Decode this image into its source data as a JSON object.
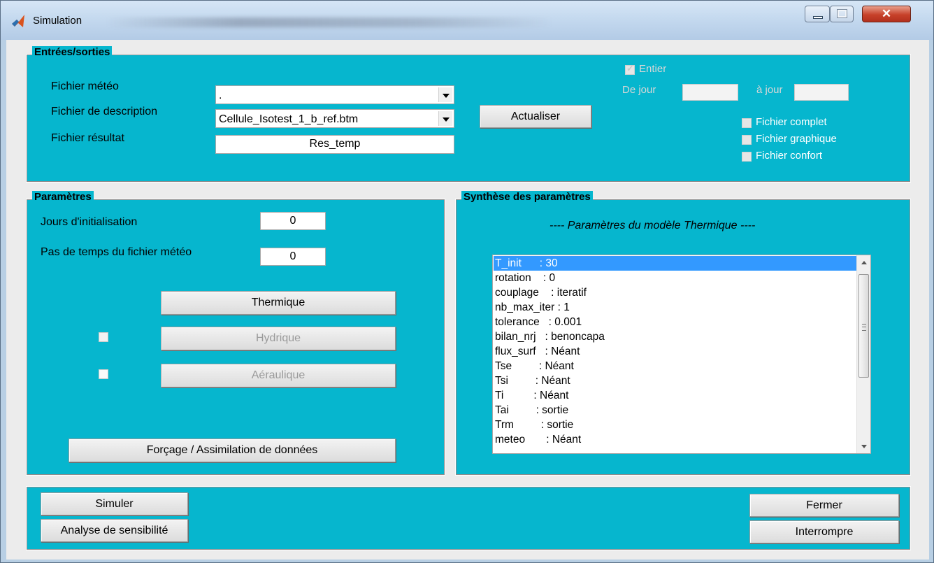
{
  "window": {
    "title": "Simulation",
    "colors": {
      "panel_bg": "#06b6ce",
      "button_bg": "#dcdcdc",
      "selection": "#3399ff"
    }
  },
  "io": {
    "title": "Entrées/sorties",
    "fichier_meteo_label": "Fichier météo",
    "fichier_meteo_value": ".",
    "fichier_description_label": "Fichier de description",
    "fichier_description_value": "Cellule_Isotest_1_b_ref.btm",
    "fichier_resultat_label": "Fichier résultat",
    "fichier_resultat_value": "Res_temp",
    "actualiser_label": "Actualiser",
    "entier_label": "Entier",
    "entier_checked": true,
    "de_jour_label": "De jour",
    "a_jour_label": "à jour",
    "fichier_complet_label": "Fichier complet",
    "fichier_graphique_label": "Fichier graphique",
    "fichier_confort_label": "Fichier confort"
  },
  "params": {
    "title": "Paramètres",
    "jours_init_label": "Jours d'initialisation",
    "jours_init_value": "0",
    "pas_temps_label": "Pas de temps du fichier météo",
    "pas_temps_value": "0",
    "thermique_label": "Thermique",
    "hydrique_label": "Hydrique",
    "aeraulique_label": "Aéraulique",
    "forcage_label": "Forçage / Assimilation de données"
  },
  "synthese": {
    "title": "Synthèse des paramètres",
    "header": "---- Paramètres du modèle Thermique ----",
    "items": [
      "T_init      : 30",
      "rotation    : 0",
      "couplage    : iteratif",
      "nb_max_iter : 1",
      "tolerance   : 0.001",
      "bilan_nrj   : benoncapa",
      "flux_surf   : Néant",
      "Tse         : Néant",
      "Tsi         : Néant",
      "Ti          : Néant",
      "Tai         : sortie",
      "Trm         : sortie",
      "meteo       : Néant"
    ],
    "selected_index": 0
  },
  "footer": {
    "simuler_label": "Simuler",
    "analyse_label": "Analyse de sensibilité",
    "fermer_label": "Fermer",
    "interrompre_label": "Interrompre"
  }
}
